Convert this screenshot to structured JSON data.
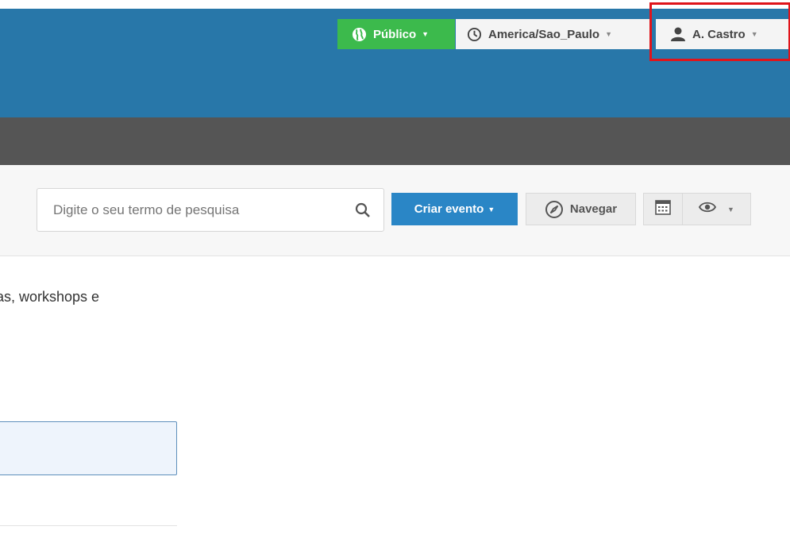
{
  "header": {
    "privacy_label": "Público",
    "timezone_label": "America/Sao_Paulo",
    "user_label": "A. Castro"
  },
  "toolbar": {
    "search_placeholder": "Digite o seu termo de pesquisa",
    "create_label": "Criar evento",
    "browse_label": "Navegar"
  },
  "content": {
    "description": "as, workshops e"
  },
  "icons": {
    "privacy": "globe-icon",
    "timezone": "clock-icon",
    "user": "user-icon",
    "search": "search-icon",
    "browse": "compass-icon",
    "calendar": "calendar-icon",
    "view": "eye-icon"
  },
  "colors": {
    "header_bg": "#2877a9",
    "subheader_bg": "#555555",
    "public_green": "#3cba4c",
    "create_blue": "#2a86c6",
    "highlight_red": "#e0141a"
  }
}
